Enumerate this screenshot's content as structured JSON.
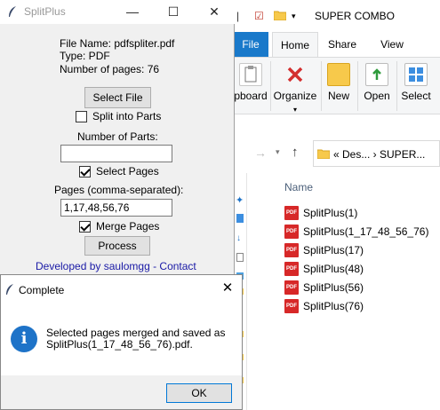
{
  "explorer": {
    "title": "SUPER COMBO",
    "tabs": [
      "File",
      "Home",
      "Share",
      "View"
    ],
    "ribbon": {
      "clipboard_label": "pboard",
      "organize_label": "Organize",
      "new_label": "New",
      "open_label": "Open",
      "select_label": "Select"
    },
    "address": "«  Des...  ›  SUPER...",
    "column_name": "Name",
    "files": [
      "SplitPlus(1)",
      "SplitPlus(1_17_48_56_76)",
      "SplitPlus(17)",
      "SplitPlus(48)",
      "SplitPlus(56)",
      "SplitPlus(76)"
    ],
    "file_icon_text": "PDF"
  },
  "splitplus": {
    "title": "SplitPlus",
    "file_name": "File Name: pdfspliter.pdf",
    "type": "Type: PDF",
    "num_pages": "Number of pages: 76",
    "select_file_label": "Select File",
    "split_into_parts_label": "Split into Parts",
    "split_into_parts_checked": false,
    "number_of_parts_label": "Number of Parts:",
    "number_of_parts_value": "",
    "select_pages_label": "Select Pages",
    "select_pages_checked": true,
    "pages_label": "Pages (comma-separated):",
    "pages_value": "1,17,48,56,76",
    "merge_pages_label": "Merge Pages",
    "merge_pages_checked": true,
    "process_label": "Process",
    "footer_link": "Developed by saulomgg - Contact"
  },
  "dialog": {
    "title": "Complete",
    "message_line1": "Selected pages merged and saved as",
    "message_line2": "SplitPlus(1_17_48_56_76).pdf.",
    "ok_label": "OK",
    "icon_glyph": "i"
  }
}
